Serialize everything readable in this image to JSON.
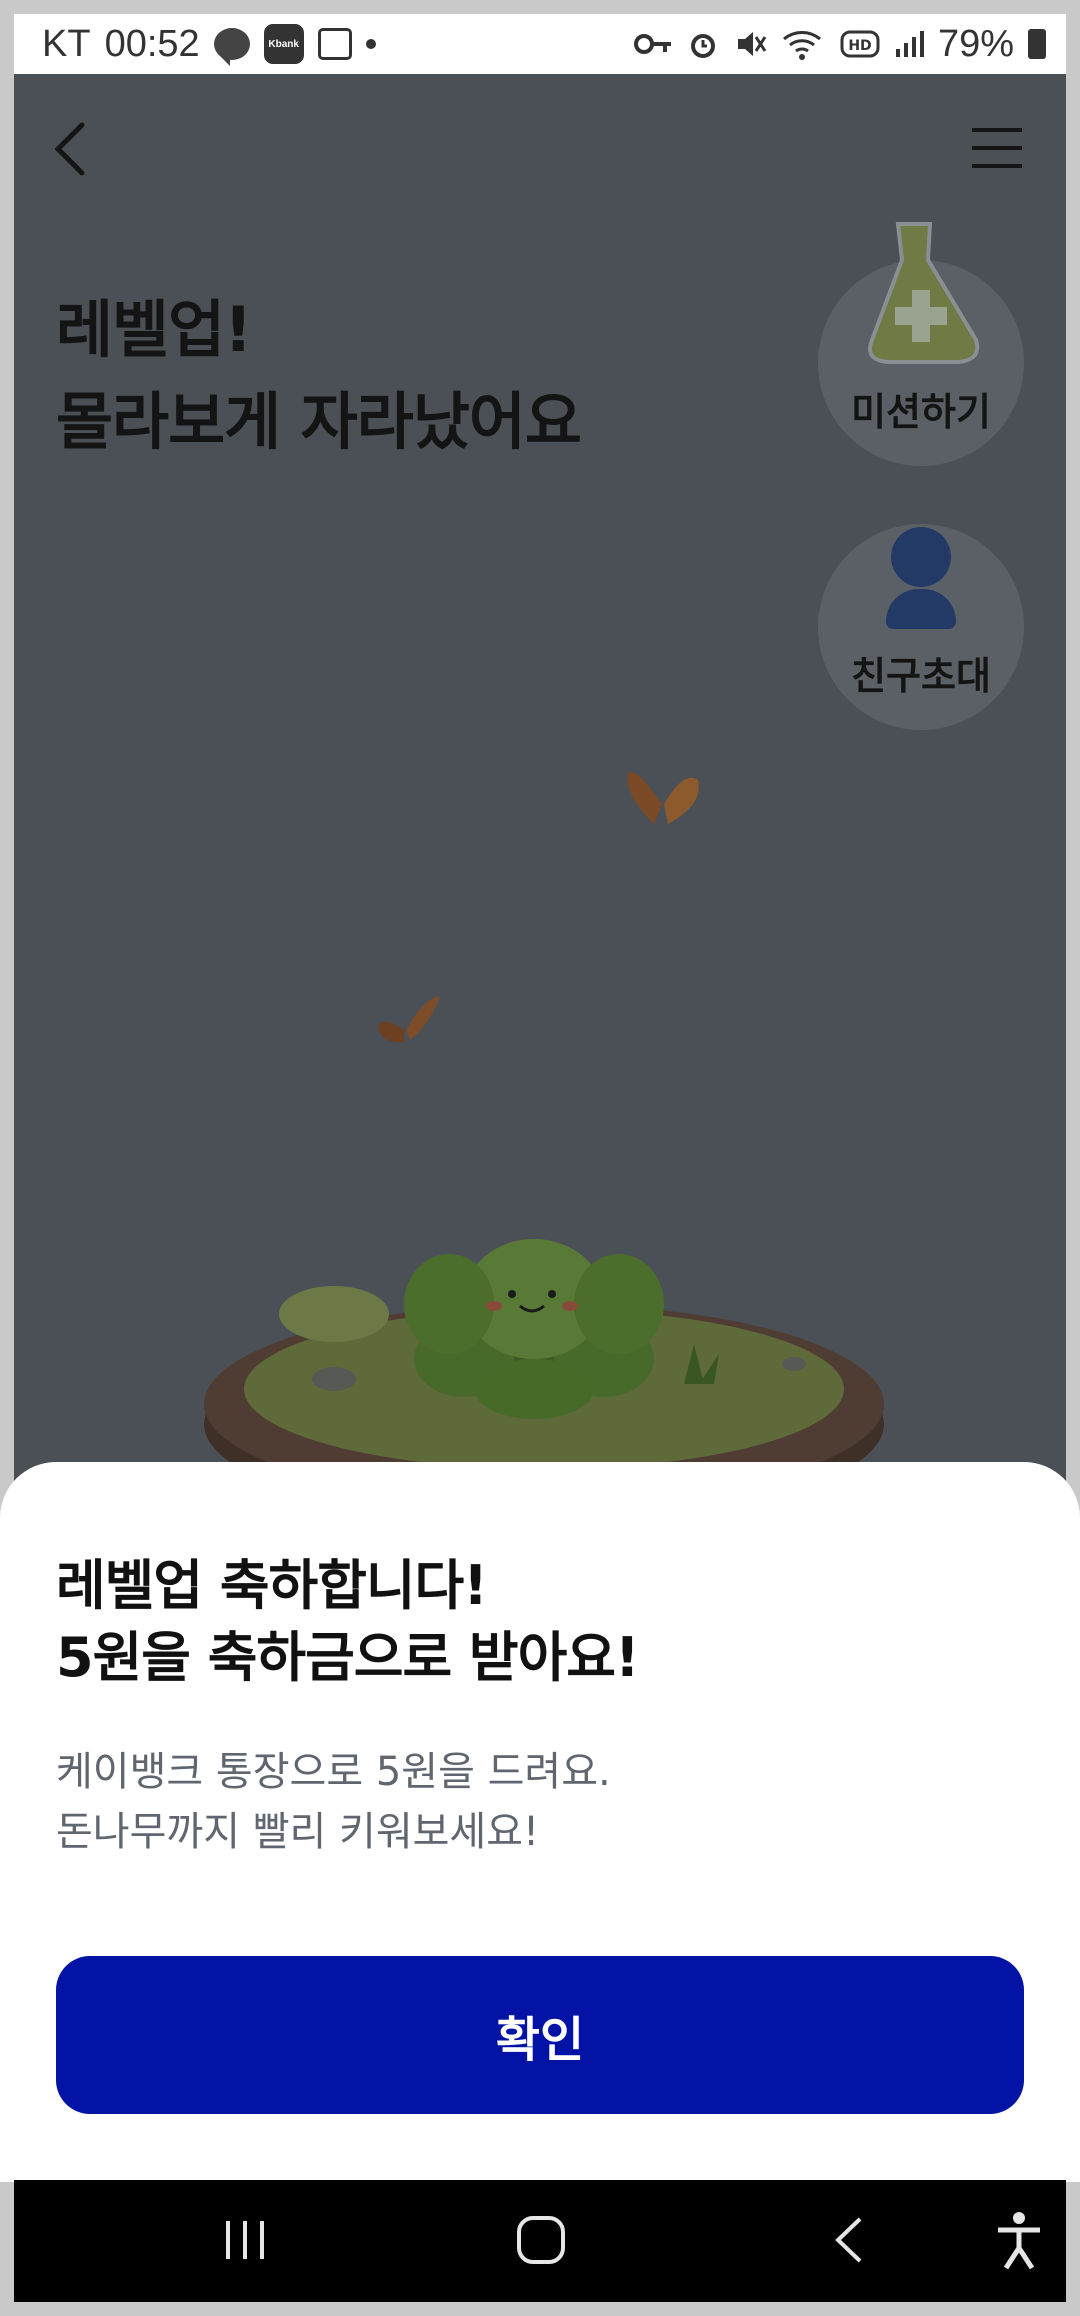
{
  "status_bar": {
    "carrier": "KT",
    "time": "00:52",
    "kbank_badge": "Kbank",
    "battery": "79%",
    "icons": [
      "chat-icon",
      "kbank-icon",
      "gallery-icon",
      "dot-icon",
      "key-icon",
      "alarm-icon",
      "mute-icon",
      "wifi-icon",
      "hd-icon",
      "signal-icon",
      "battery-icon"
    ]
  },
  "header": {
    "back_icon": "chevron-left-icon",
    "menu_icon": "hamburger-menu-icon"
  },
  "headline": {
    "line1": "레벨업!",
    "line2": "몰라보게 자라났어요"
  },
  "side_buttons": {
    "mission_label": "미션하기",
    "invite_label": "친구초대"
  },
  "sheet": {
    "title_line1": "레벨업 축하합니다!",
    "title_line2": "5원을 축하금으로 받아요!",
    "desc_line1": "케이뱅크 통장으로 5원을 드려요.",
    "desc_line2": "돈나무까지 빨리 키워보세요!",
    "confirm_label": "확인"
  },
  "colors": {
    "overlay": "#4b5056",
    "primary_button": "#0213a6",
    "sheet_bg": "#ffffff"
  }
}
